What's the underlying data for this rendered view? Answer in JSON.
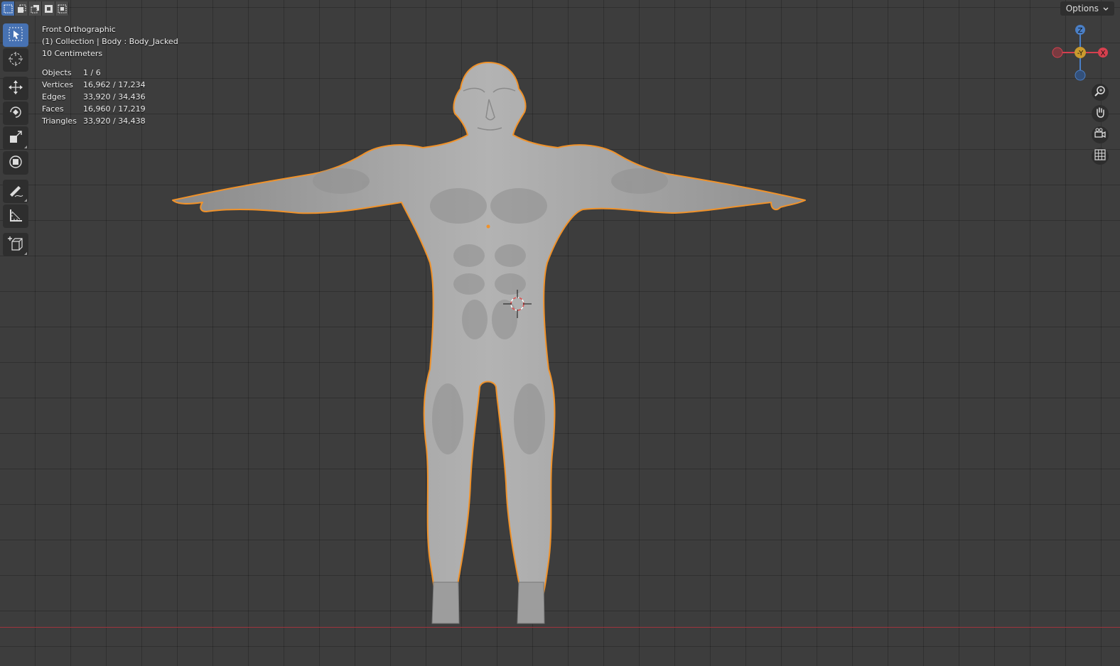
{
  "header": {
    "options_label": "Options",
    "select_modes": [
      "select-new-icon",
      "select-extend-icon",
      "select-subtract-icon",
      "select-invert-icon",
      "select-intersect-icon"
    ]
  },
  "toolbar": {
    "tools": [
      "select-box-icon",
      "cursor-icon",
      "move-icon",
      "rotate-icon",
      "scale-icon",
      "transform-icon",
      "annotate-icon",
      "measure-icon",
      "add-cube-icon"
    ]
  },
  "overlay": {
    "view_name": "Front Orthographic",
    "collection_line": "(1) Collection | Body : Body_Jacked",
    "scale": "10 Centimeters",
    "stats": [
      {
        "label": "Objects",
        "value": "1 / 6"
      },
      {
        "label": "Vertices",
        "value": "16,962 / 17,234"
      },
      {
        "label": "Edges",
        "value": "33,920 / 34,436"
      },
      {
        "label": "Faces",
        "value": "16,960 / 17,219"
      },
      {
        "label": "Triangles",
        "value": "33,920 / 34,438"
      }
    ]
  },
  "gizmo": {
    "z_label": "Z",
    "y_label": "-Y",
    "x_label": "X",
    "colors": {
      "x": "#d6404f",
      "y": "#c99a2e",
      "z": "#4a7fc6"
    }
  },
  "nav_buttons": [
    "zoom-icon",
    "pan-hand-icon",
    "camera-icon",
    "grid-icon"
  ],
  "colors": {
    "background": "#3d3d3d",
    "selection_outline": "#f0922a",
    "active_tool": "#4772b3"
  }
}
